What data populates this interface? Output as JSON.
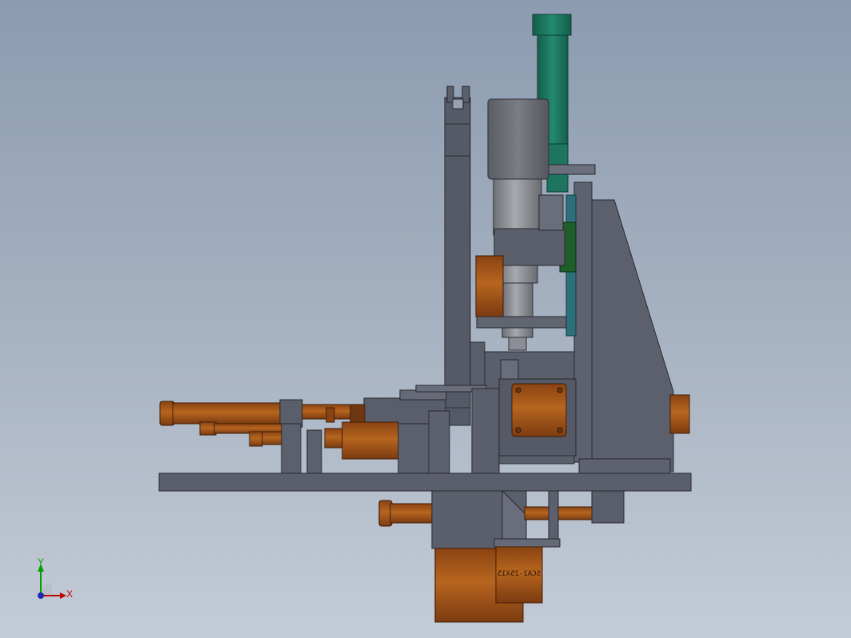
{
  "model": {
    "part_label": "SCA2-25X15"
  },
  "triad": {
    "x_label": "X",
    "y_label": "Y"
  },
  "colors": {
    "background_top": "#8c9bb0",
    "background_bottom": "#c3cbd6",
    "frame_grey": "#5a5e6b",
    "orange_component": "#a9531a",
    "green_cylinder": "#1c7a63",
    "motor_grey": "#6a6d74",
    "teal_plate": "#2e6f7c",
    "dark_green_block": "#1e5e2a",
    "x_axis": "#c00000",
    "y_axis": "#00a000"
  }
}
